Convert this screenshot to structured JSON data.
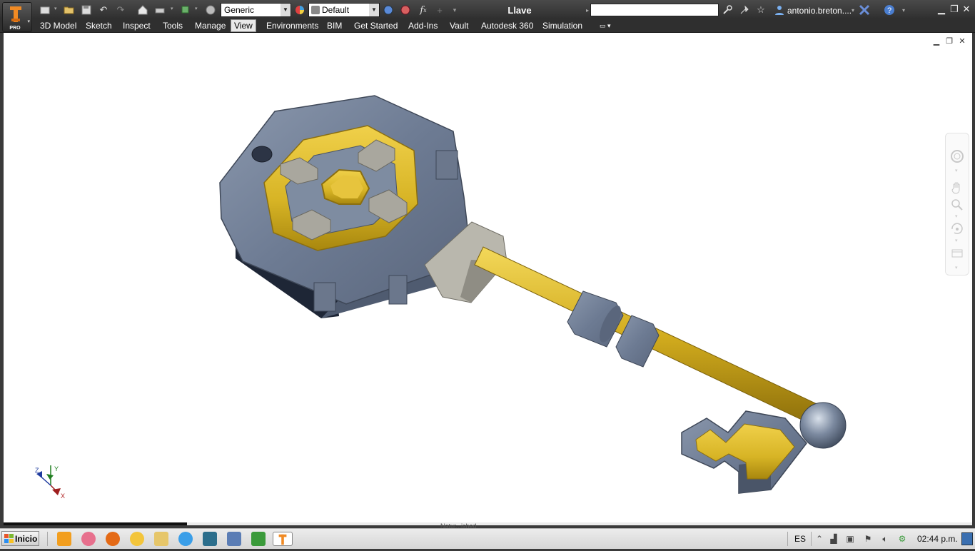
{
  "app": {
    "badge": "PRO",
    "title": "Llave"
  },
  "toolbar": {
    "material_combo": "Generic",
    "appearance_combo": "Default",
    "fx_label": "f",
    "fx_sub": "x",
    "search_placeholder": "",
    "user": "antonio.breton...."
  },
  "ribbon": {
    "tabs": [
      {
        "label": "3D Model"
      },
      {
        "label": "Sketch"
      },
      {
        "label": "Inspect"
      },
      {
        "label": "Tools"
      },
      {
        "label": "Manage"
      },
      {
        "label": "View"
      },
      {
        "label": "Environments"
      },
      {
        "label": "BIM"
      },
      {
        "label": "Get Started"
      },
      {
        "label": "Add-Ins"
      },
      {
        "label": "Vault"
      },
      {
        "label": "Autodesk 360"
      },
      {
        "label": "Simulation"
      }
    ],
    "active_tab": "View"
  },
  "viewport": {
    "triad": {
      "x": "X",
      "y": "Y",
      "z": "Z"
    },
    "status_text": "Natur...ished"
  },
  "taskbar": {
    "start_label": "Inicio",
    "language": "ES",
    "clock": "02:44 p.m."
  },
  "colors": {
    "accent_gold": "#d8b423",
    "metal_blue": "#7f8ea3",
    "titlebar": "#3a3a3a",
    "active_tab": "#e9e9e9"
  }
}
